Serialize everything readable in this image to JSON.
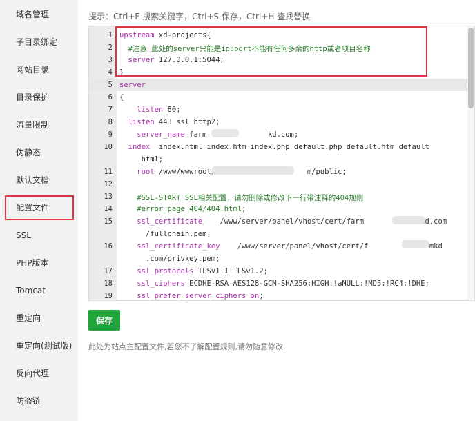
{
  "sidebar": {
    "items": [
      {
        "label": "域名管理"
      },
      {
        "label": "子目录绑定"
      },
      {
        "label": "网站目录"
      },
      {
        "label": "目录保护"
      },
      {
        "label": "流量限制"
      },
      {
        "label": "伪静态"
      },
      {
        "label": "默认文档"
      },
      {
        "label": "配置文件"
      },
      {
        "label": "SSL"
      },
      {
        "label": "PHP版本"
      },
      {
        "label": "Tomcat"
      },
      {
        "label": "重定向"
      },
      {
        "label": "重定向(测试版)"
      },
      {
        "label": "反向代理"
      },
      {
        "label": "防盗链"
      }
    ],
    "active_index": 7
  },
  "hint": "提示：Ctrl+F 搜索关键字，Ctrl+S 保存，Ctrl+H 查找替换",
  "editor": {
    "lines": [
      {
        "num": "1",
        "text": "upstream xd-projects{"
      },
      {
        "num": "2",
        "text": "  #注意 此处的server只能是ip:port不能有任何多余的http或者项目名称"
      },
      {
        "num": "3",
        "text": "  server 127.0.0.1:5044;"
      },
      {
        "num": "4",
        "text": "}"
      },
      {
        "num": "5",
        "text": "server"
      },
      {
        "num": "6",
        "text": "{"
      },
      {
        "num": "7",
        "text": "    listen 80;"
      },
      {
        "num": "8",
        "text": "  listen 443 ssl http2;"
      },
      {
        "num": "9",
        "text": "    server_name farm              kd.com;"
      },
      {
        "num": "10",
        "text": "  index  index.html index.htm index.php default.php default.htm default"
      },
      {
        "num": "",
        "text": "    .html;"
      },
      {
        "num": "11",
        "text": "    root /www/wwwroot/far                  m/public;"
      },
      {
        "num": "12",
        "text": ""
      },
      {
        "num": "13",
        "text": "    #SSL-START SSL相关配置，请勿删除或修改下一行带注释的404规则"
      },
      {
        "num": "14",
        "text": "    #error_page 404/404.html;"
      },
      {
        "num": "15",
        "text": "    ssl_certificate    /www/server/panel/vhost/cert/farm            mkd.com"
      },
      {
        "num": "",
        "text": "      /fullchain.pem;"
      },
      {
        "num": "16",
        "text": "    ssl_certificate_key    /www/server/panel/vhost/cert/f            armkd"
      },
      {
        "num": "",
        "text": "      .com/privkey.pem;"
      },
      {
        "num": "17",
        "text": "    ssl_protocols TLSv1.1 TLSv1.2;"
      },
      {
        "num": "18",
        "text": "    ssl_ciphers ECDHE-RSA-AES128-GCM-SHA256:HIGH:!aNULL:!MD5:!RC4:!DHE;"
      },
      {
        "num": "19",
        "text": "    ssl_prefer_server_ciphers on;"
      }
    ]
  },
  "save_label": "保存",
  "note": "此处为站点主配置文件,若您不了解配置规则,请勿随意修改.",
  "colors": {
    "accent": "#20a53a",
    "highlight_border": "#d9363e",
    "keyword": "#b030b0",
    "comment": "#2d7d2d"
  }
}
